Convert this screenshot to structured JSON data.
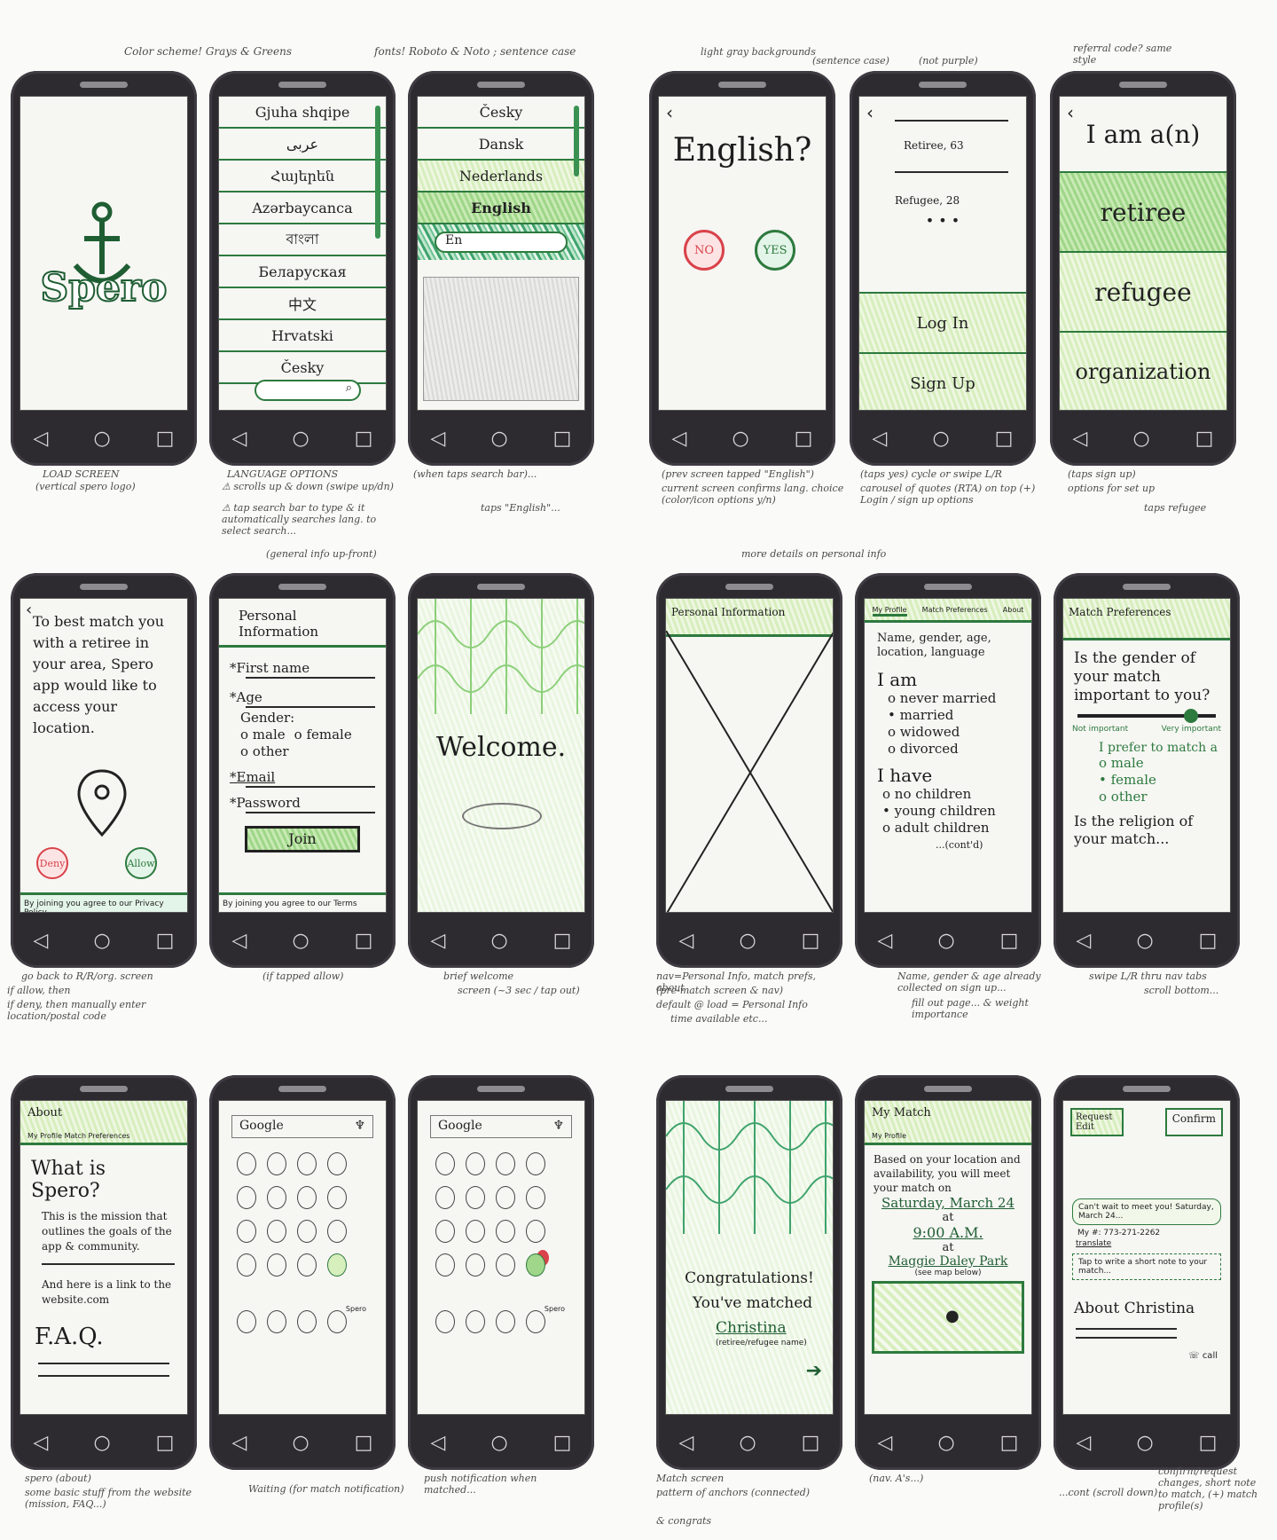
{
  "colors": {
    "green_dark": "#2d7a3e",
    "green_mid": "#3fa36d",
    "green_light": "#d7eebd",
    "red": "#d9424a",
    "phone": "#2d2a30"
  },
  "top_notes": {
    "colors": "Color scheme! Grays & Greens",
    "fonts": "fonts! Roboto & Noto ; sentence case",
    "light_backgrounds": "light gray backgrounds",
    "sentence_case": "(sentence case)",
    "not_purple": "(not purple)",
    "referral": "referral code? same style"
  },
  "screens": {
    "load": {
      "logo_text": "Spero",
      "caption": "LOAD SCREEN",
      "sub": "(vertical spero logo)"
    },
    "languages": {
      "items": [
        "Gjuha shqipe",
        "عربى",
        "Հայերեն",
        "Azərbaycanca",
        "বাংলা",
        "Беларуская",
        "中文",
        "Hrvatski",
        "Česky"
      ],
      "caption": "LANGUAGE OPTIONS",
      "sub1": "⚠ scrolls up & down (swipe up/dn)",
      "sub2": "⚠ tap search bar to type & it automatically searches lang. to select search..."
    },
    "lang_search": {
      "items": [
        "Česky",
        "Dansk",
        "Nederlands",
        "English"
      ],
      "input": "En",
      "caption": "(when taps search bar)...",
      "sub": "taps \"English\"..."
    },
    "confirm": {
      "question": "English?",
      "no": "NO",
      "yes": "YES",
      "caption": "(prev screen tapped \"English\")",
      "sub": "current screen confirms lang. choice (color/icon options y/n)"
    },
    "carousel": {
      "quote1": "Retiree, 63",
      "quote2": "Refugee, 28",
      "login": "Log In",
      "signup": "Sign Up",
      "caption": "(taps yes) cycle or swipe L/R",
      "sub": "carousel of quotes (RTA) on top (+) Login / sign up options"
    },
    "iam": {
      "title": "I am a(n)",
      "options": [
        "retiree",
        "refugee",
        "organization"
      ],
      "caption": "(taps sign up)",
      "sub": "options for set up",
      "sub2": "taps refugee"
    },
    "location": {
      "text": "To best match you with a retiree in your area, Spero app would like to access your location.",
      "deny": "Deny",
      "allow": "Allow",
      "footer": "By joining you agree to our Privacy Policy",
      "caption": "go back to R/R/org. screen",
      "sub1": "if allow, then",
      "sub2": "if deny, then manually enter location/postal code"
    },
    "personal": {
      "title": "Personal Information",
      "first": "*First name",
      "age": "*Age",
      "gender": "Gender:",
      "male": "o male",
      "female": "o female",
      "other": "o other",
      "email": "*Email",
      "password": "*Password",
      "join": "Join",
      "footer": "By joining you agree to our Terms",
      "top_note": "(general info up-front)",
      "caption": "(if tapped allow)"
    },
    "welcome": {
      "text": "Welcome.",
      "caption": "brief welcome",
      "sub": "screen (~3 sec / tap out)"
    },
    "profile_x": {
      "title": "Personal Information",
      "top_note": "more details on personal info",
      "caption": "nav=Personal Info, match prefs, about",
      "sub1": "(pre-match screen & nav)",
      "sub2": "default @ load = Personal Info",
      "sub3": "time available etc..."
    },
    "profile": {
      "tabs": [
        "My Profile",
        "Match Preferences",
        "About"
      ],
      "head": "Name, gender, age, location, language",
      "iam": "I am",
      "marital": [
        "o never married",
        "• married",
        "o widowed",
        "o divorced"
      ],
      "ihave": "I have",
      "kids": [
        "o no children",
        "• young children",
        "o adult children"
      ],
      "cont": "...(cont'd)",
      "caption": "Name, gender & age already collected on sign up...",
      "sub": "fill out page... & weight importance"
    },
    "match_prefs": {
      "title": "Match Preferences",
      "question": "Is the gender of your match important to you?",
      "not": "Not important",
      "very": "Very important",
      "prefer": "I prefer to match a",
      "options": [
        "o male",
        "• female",
        "o other"
      ],
      "q2": "Is the religion of your match...",
      "caption": "swipe L/R thru nav tabs",
      "sub": "scroll bottom..."
    },
    "about": {
      "title": "About",
      "tabs": "My Profile  Match Preferences",
      "heading": "What is Spero?",
      "mission": "This is the mission that outlines the goals of the app & community.",
      "link": "And here is a link to the website.com",
      "faq": "F.A.Q.",
      "caption": "spero (about)",
      "sub": "some basic stuff from the website (mission, FAQ...)"
    },
    "waiting": {
      "search": "Google",
      "app": "Spero",
      "caption": "Waiting (for match notification)"
    },
    "push": {
      "search": "Google",
      "app": "Spero",
      "caption": "push notification when matched..."
    },
    "congrats": {
      "line1": "Congratulations!",
      "line2": "You've matched",
      "name": "Christina",
      "sub": "(retiree/refugee name)",
      "caption": "Match screen",
      "sub1": "pattern of anchors (connected)",
      "sub2": "& congrats"
    },
    "my_match": {
      "title": "My Match",
      "tabs": "My Profile",
      "text": "Based on your location and availability, you will meet your match on",
      "date": "Saturday, March 24",
      "at": "at",
      "time": "9:00 A.M.",
      "at2": "at",
      "place": "Maggie Daley Park",
      "map_note": "(see map below)",
      "caption": "(nav. A's...)"
    },
    "confirm_match": {
      "request": "Request Edit",
      "confirm": "Confirm",
      "note1": "Can't wait to meet you! Saturday, March 24...",
      "phone": "My #: 773-271-2262",
      "translate": "translate",
      "note2": "Tap to write a short note to your match...",
      "about": "About Christina",
      "call": "call",
      "caption": "...cont (scroll down)",
      "sub": "confirm/request changes, short note to match, (+) match profile(s)"
    }
  }
}
